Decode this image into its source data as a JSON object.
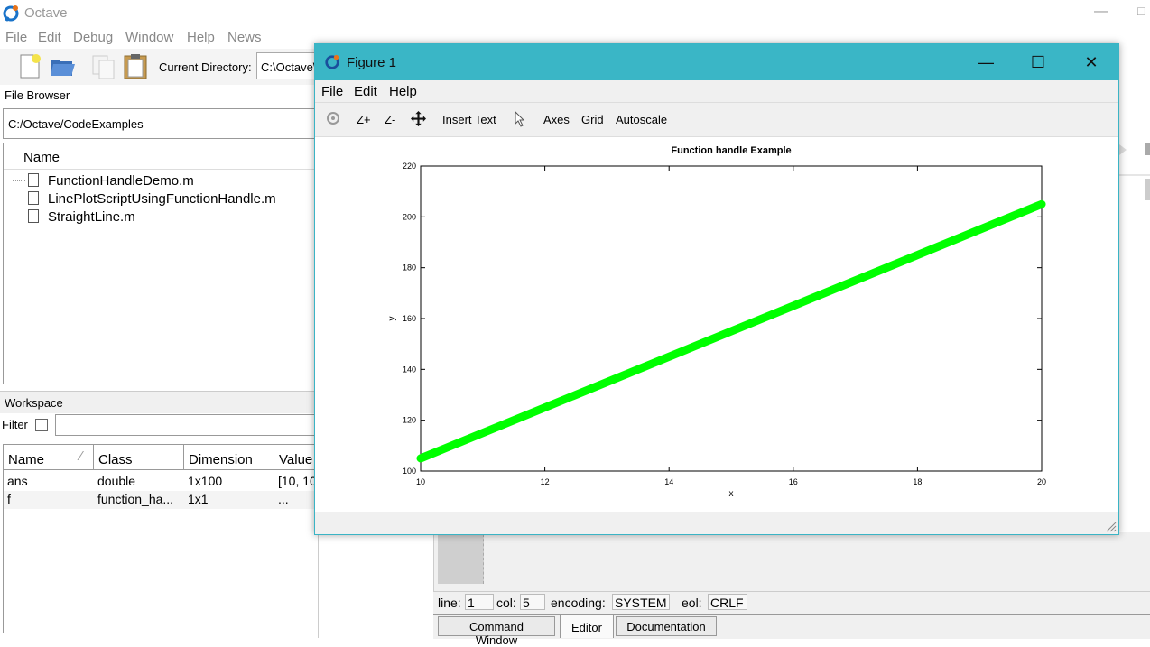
{
  "app": {
    "title": "Octave",
    "window_controls": {
      "minimize": "—",
      "maximize": "□"
    }
  },
  "menubar": [
    "File",
    "Edit",
    "Debug",
    "Window",
    "Help",
    "News"
  ],
  "toolbar": {
    "icons": [
      "new-file-icon",
      "open-folder-icon",
      "copy-icon",
      "paste-icon"
    ],
    "current_directory_label": "Current Directory:",
    "current_directory_value": "C:\\Octave\\"
  },
  "file_browser": {
    "header": "File Browser",
    "path": "C:/Octave/CodeExamples",
    "column_name": "Name",
    "files": [
      "FunctionHandleDemo.m",
      "LinePlotScriptUsingFunctionHandle.m",
      "StraightLine.m"
    ]
  },
  "workspace": {
    "header": "Workspace",
    "filter_label": "Filter",
    "columns": [
      "Name",
      "Class",
      "Dimension",
      "Value"
    ],
    "rows": [
      {
        "name": "ans",
        "class": "double",
        "dimension": "1x100",
        "value": "[10, 10"
      },
      {
        "name": "f",
        "class": "function_ha...",
        "dimension": "1x1",
        "value": "..."
      }
    ]
  },
  "statusbar": {
    "line_label": "line:",
    "line_value": "1",
    "col_label": "col:",
    "col_value": "5",
    "encoding_label": "encoding:",
    "encoding_value": "SYSTEM",
    "eol_label": "eol:",
    "eol_value": "CRLF"
  },
  "bottom_tabs": [
    {
      "label": "Command Window",
      "active": false
    },
    {
      "label": "Editor",
      "active": true
    },
    {
      "label": "Documentation",
      "active": false
    }
  ],
  "figure": {
    "title": "Figure 1",
    "controls": {
      "minimize": "—",
      "maximize": "☐",
      "close": "✕"
    },
    "menu": [
      "File",
      "Edit",
      "Help"
    ],
    "toolbar": {
      "rotate_icon": "rotate-icon",
      "zoom_in": "Z+",
      "zoom_out": "Z-",
      "pan_icon": "pan-icon",
      "insert_text": "Insert Text",
      "select_icon": "pointer-icon",
      "axes": "Axes",
      "grid": "Grid",
      "autoscale": "Autoscale"
    }
  },
  "chart_data": {
    "type": "line",
    "title": "Function handle Example",
    "xlabel": "x",
    "ylabel": "y",
    "xlim": [
      10,
      20
    ],
    "ylim": [
      100,
      220
    ],
    "xticks": [
      10,
      12,
      14,
      16,
      18,
      20
    ],
    "yticks": [
      100,
      120,
      140,
      160,
      180,
      200,
      220
    ],
    "grid": false,
    "series": [
      {
        "color": "#00ff00",
        "x": [
          10,
          20
        ],
        "y": [
          105,
          205
        ]
      }
    ]
  }
}
